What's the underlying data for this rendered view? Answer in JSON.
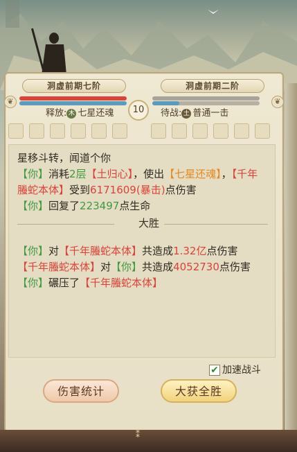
{
  "header": {
    "left_rank": "洞虚前期七阶",
    "right_rank": "洞虚前期二阶",
    "round": "10",
    "left_skill_label": "释放:",
    "left_skill_icon": "木",
    "left_skill_name": "七星还魂",
    "right_skill_label": "待战:",
    "right_skill_icon": "土",
    "right_skill_name": "普通一击",
    "left_hp_fraction": 1.0,
    "right_hp_fraction": 0.25
  },
  "log": {
    "line1": "星移斗转，闻道个你",
    "l2_you": "【你】",
    "l2_consume": "消耗",
    "l2_level": "2层",
    "l2_tuguixin": "【土归心】",
    "l2_useout": "，使出",
    "l2_skill": "【七星还魂】",
    "l2_comma": "，",
    "l2_boss": "【千年螣蛇本体】",
    "l2_receive": "受到",
    "l2_damage": "6171609(暴击)",
    "l2_point": "点",
    "l2_harm": "伤害",
    "l3_you": "【你】",
    "l3_restore": "回复了",
    "l3_amount": "223497",
    "l3_hp": "点生命",
    "divider": "大胜",
    "l4_you": "【你】",
    "l4_to": "对",
    "l4_boss": "【千年螣蛇本体】",
    "l4_total": "共造成",
    "l4_amount": "1.32亿",
    "l4_harm": "点伤害",
    "l5_boss": "【千年螣蛇本体】",
    "l5_to": "对",
    "l5_you": "【你】",
    "l5_total": "共造成",
    "l5_amount": "4052730",
    "l5_harm": "点伤害",
    "l6_you": "【你】",
    "l6_crush": "碾压了",
    "l6_boss": "【千年螣蛇本体】"
  },
  "speedup": {
    "label": "加速战斗",
    "checked": true
  },
  "buttons": {
    "stats": "伤害统计",
    "victory": "大获全胜"
  },
  "colors": {
    "green": "#3f9a3f",
    "red": "#d8443a",
    "orange": "#e6881f"
  }
}
